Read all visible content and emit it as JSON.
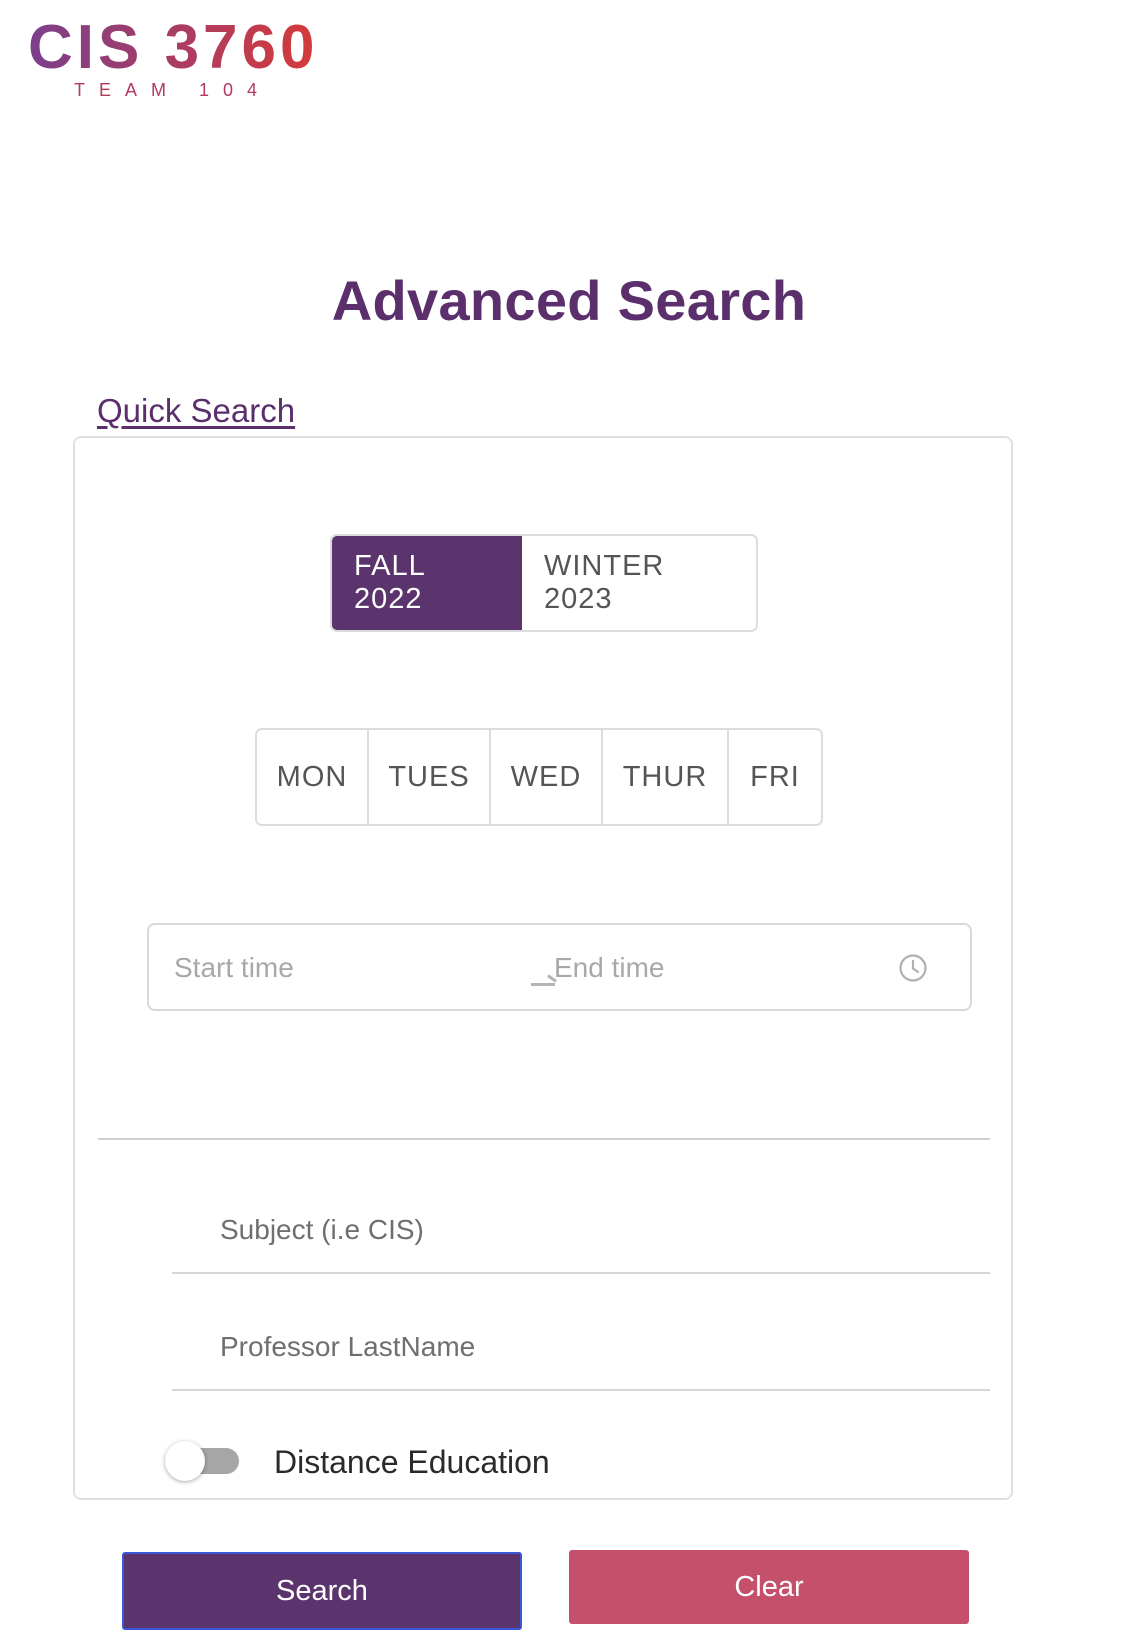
{
  "logo": {
    "main_text": "CIS 3760",
    "sub_text": "TEAM 104",
    "colors": {
      "start": "#7b3f8c",
      "end": "#d63a3a"
    }
  },
  "page_title": "Advanced Search",
  "quick_search_link": "Quick Search",
  "terms": {
    "options": [
      "FALL 2022",
      "WINTER 2023"
    ],
    "selected": "FALL 2022"
  },
  "days": [
    "MON",
    "TUES",
    "WED",
    "THUR",
    "FRI"
  ],
  "time_range": {
    "start_placeholder": "Start time",
    "end_placeholder": "End time",
    "icon": "clock-icon"
  },
  "fields": {
    "subject_placeholder": "Subject (i.e CIS)",
    "professor_placeholder": "Professor LastName"
  },
  "distance_education": {
    "label": "Distance Education",
    "enabled": false
  },
  "actions": {
    "search_label": "Search",
    "clear_label": "Clear"
  },
  "colors": {
    "primary": "#5b346e",
    "clear": "#c5506c",
    "focus_border": "#3a57d8"
  }
}
